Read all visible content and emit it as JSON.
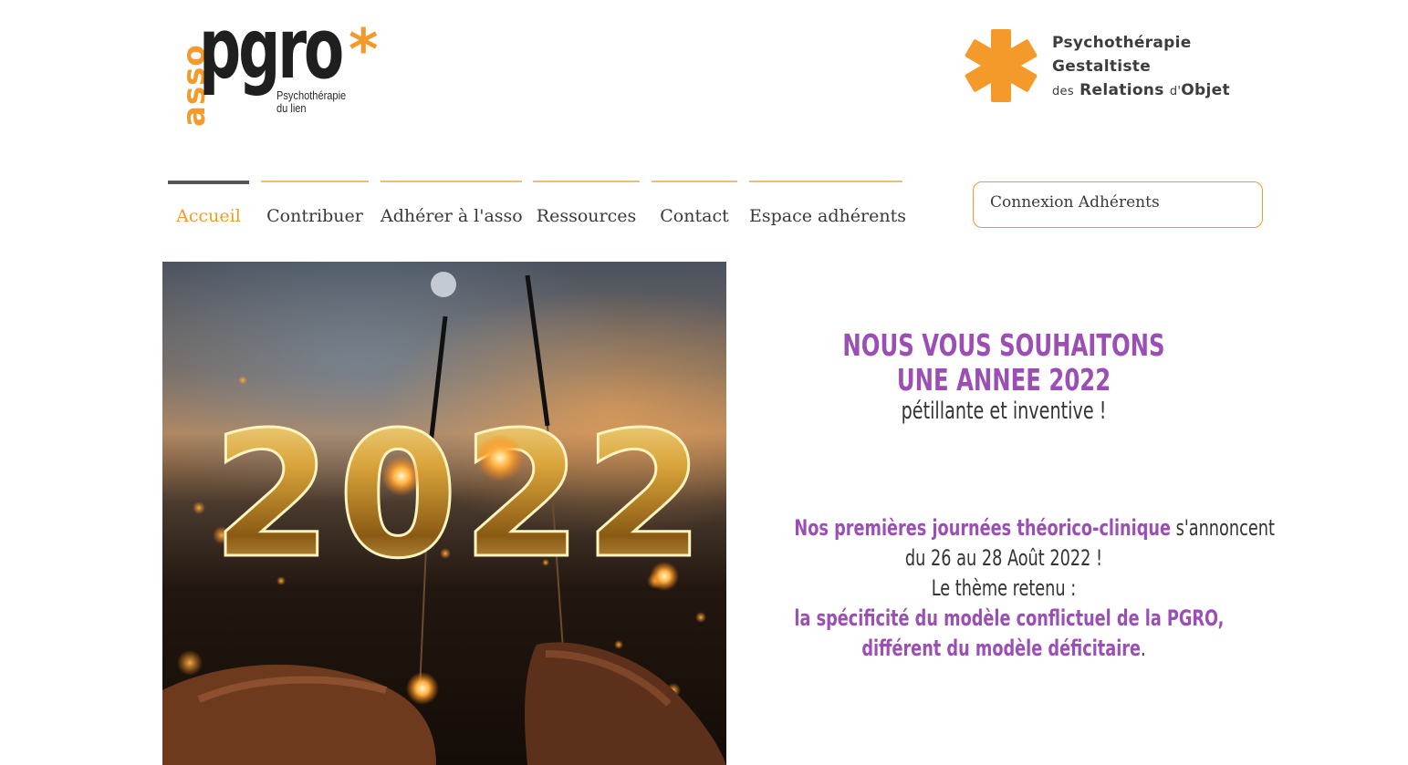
{
  "logo": {
    "asso": "asso",
    "pgro": "pgro",
    "star": "*",
    "tagline_1": "Psychothérapie",
    "tagline_2": "du lien"
  },
  "brand": {
    "line1": "Psychothérapie",
    "line2": "Gestaltiste",
    "line3_des": "des",
    "line3_relations": "Relations",
    "line3_d": "d'",
    "line3_objet": "Objet"
  },
  "nav": {
    "items": [
      {
        "label": "Accueil"
      },
      {
        "label": "Contribuer"
      },
      {
        "label": "Adhérer à l'asso"
      },
      {
        "label": "Ressources"
      },
      {
        "label": "Contact"
      },
      {
        "label": "Espace adhérents"
      }
    ],
    "active_index": 0
  },
  "login": {
    "label": "Connexion Adhérents"
  },
  "hero": {
    "year": "2022"
  },
  "wishes": {
    "line1": "NOUS VOUS SOUHAITONS",
    "line2": "UNE ANNEE 2022",
    "line3": "pétillante et inventive !"
  },
  "journees": {
    "l1_purple": "Nos premières journées théorico-clinique",
    "l1_rest": " s'annoncent",
    "l2": "du 26 au 28 Août 2022 !",
    "l3": "Le thème retenu :",
    "l4": "la spécificité du modèle conflictuel de la PGRO,",
    "l5_purple": "différent du modèle déficitaire",
    "l5_rest": "."
  },
  "colors": {
    "accent_orange": "#f39a2b",
    "purple": "#9b4fb4",
    "text_dark": "#333333"
  }
}
